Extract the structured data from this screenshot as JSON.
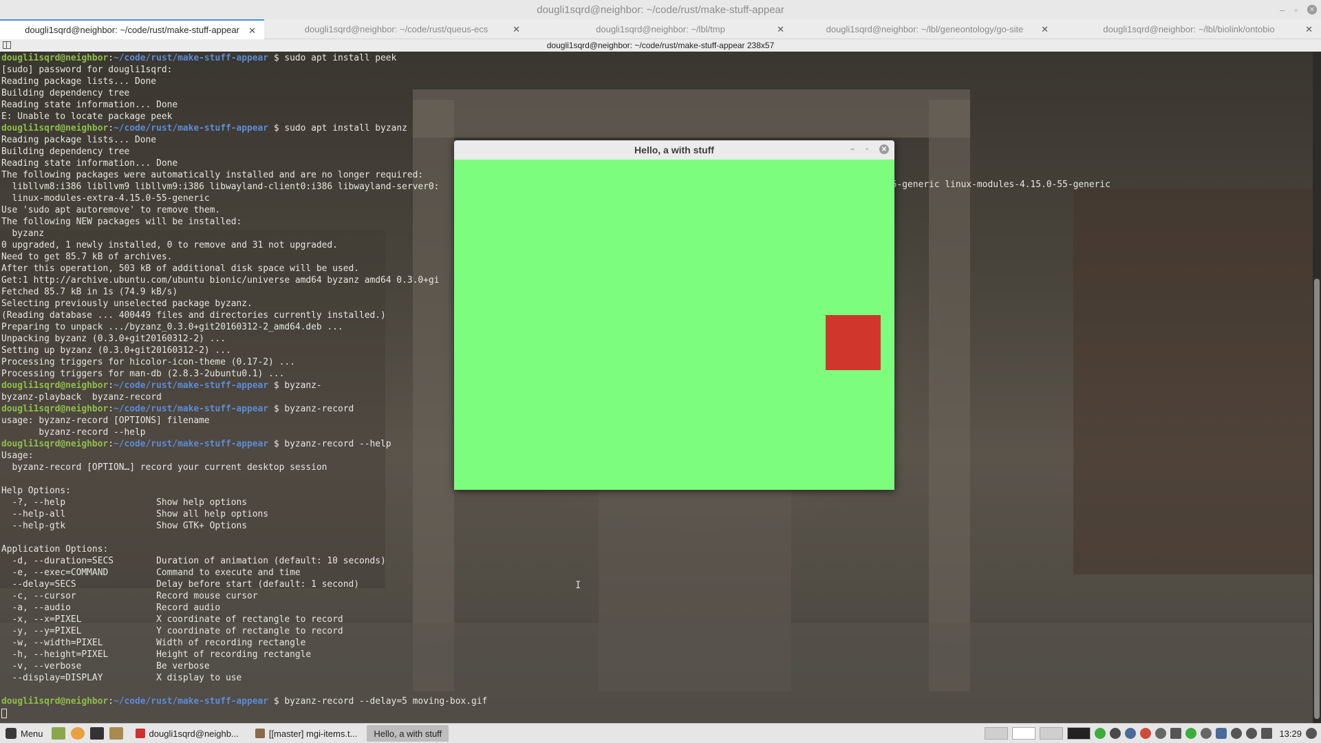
{
  "window": {
    "title": "dougli1sqrd@neighbor: ~/code/rust/make-stuff-appear",
    "subtitle": "dougli1sqrd@neighbor: ~/code/rust/make-stuff-appear 238x57",
    "minimize": "–",
    "maximize": "▫",
    "close": "✕"
  },
  "tabs": [
    {
      "label": "dougli1sqrd@neighbor: ~/code/rust/make-stuff-appear",
      "close": "✕"
    },
    {
      "label": "dougli1sqrd@neighbor: ~/code/rust/queus-ecs",
      "close": "✕"
    },
    {
      "label": "dougli1sqrd@neighbor: ~/lbl/tmp",
      "close": "✕"
    },
    {
      "label": "dougli1sqrd@neighbor: ~/lbl/geneontology/go-site",
      "close": "✕"
    },
    {
      "label": "dougli1sqrd@neighbor: ~/lbl/biolink/ontobio",
      "close": "✕"
    }
  ],
  "prompt": {
    "user": "dougli1sqrd@neighbor",
    "path": "~/code/rust/make-stuff-appear"
  },
  "terminal": {
    "lines": [
      {
        "type": "prompt",
        "cmd": " $ sudo apt install peek"
      },
      {
        "type": "out",
        "text": "[sudo] password for dougli1sqrd:"
      },
      {
        "type": "out",
        "text": "Reading package lists... Done"
      },
      {
        "type": "out",
        "text": "Building dependency tree"
      },
      {
        "type": "out",
        "text": "Reading state information... Done"
      },
      {
        "type": "out",
        "text": "E: Unable to locate package peek"
      },
      {
        "type": "prompt",
        "cmd": " $ sudo apt install byzanz"
      },
      {
        "type": "out",
        "text": "Reading package lists... Done"
      },
      {
        "type": "out",
        "text": "Building dependency tree"
      },
      {
        "type": "out",
        "text": "Reading state information... Done"
      },
      {
        "type": "out",
        "text": "The following packages were automatically installed and are no longer required:"
      },
      {
        "type": "out",
        "text": "  libllvm8:i386 libllvm9 libllvm9:i386 libwayland-client0:i386 libwayland-server0:"
      },
      {
        "type": "out",
        "text": "  linux-modules-extra-4.15.0-55-generic"
      },
      {
        "type": "out",
        "text": "Use 'sudo apt autoremove' to remove them."
      },
      {
        "type": "out",
        "text": "The following NEW packages will be installed:"
      },
      {
        "type": "out",
        "text": "  byzanz"
      },
      {
        "type": "out",
        "text": "0 upgraded, 1 newly installed, 0 to remove and 31 not upgraded."
      },
      {
        "type": "out",
        "text": "Need to get 85.7 kB of archives."
      },
      {
        "type": "out",
        "text": "After this operation, 503 kB of additional disk space will be used."
      },
      {
        "type": "out",
        "text": "Get:1 http://archive.ubuntu.com/ubuntu bionic/universe amd64 byzanz amd64 0.3.0+gi"
      },
      {
        "type": "out",
        "text": "Fetched 85.7 kB in 1s (74.9 kB/s)"
      },
      {
        "type": "out",
        "text": "Selecting previously unselected package byzanz."
      },
      {
        "type": "out",
        "text": "(Reading database ... 400449 files and directories currently installed.)"
      },
      {
        "type": "out",
        "text": "Preparing to unpack .../byzanz_0.3.0+git20160312-2_amd64.deb ..."
      },
      {
        "type": "out",
        "text": "Unpacking byzanz (0.3.0+git20160312-2) ..."
      },
      {
        "type": "out",
        "text": "Setting up byzanz (0.3.0+git20160312-2) ..."
      },
      {
        "type": "out",
        "text": "Processing triggers for hicolor-icon-theme (0.17-2) ..."
      },
      {
        "type": "out",
        "text": "Processing triggers for man-db (2.8.3-2ubuntu0.1) ..."
      },
      {
        "type": "prompt",
        "cmd": " $ byzanz-"
      },
      {
        "type": "out",
        "text": "byzanz-playback  byzanz-record"
      },
      {
        "type": "prompt",
        "cmd": " $ byzanz-record"
      },
      {
        "type": "out",
        "text": "usage: byzanz-record [OPTIONS] filename"
      },
      {
        "type": "out",
        "text": "       byzanz-record --help"
      },
      {
        "type": "prompt",
        "cmd": " $ byzanz-record --help"
      },
      {
        "type": "out",
        "text": "Usage:"
      },
      {
        "type": "out",
        "text": "  byzanz-record [OPTION…] record your current desktop session"
      },
      {
        "type": "out",
        "text": ""
      },
      {
        "type": "out",
        "text": "Help Options:"
      },
      {
        "type": "out",
        "text": "  -?, --help                 Show help options"
      },
      {
        "type": "out",
        "text": "  --help-all                 Show all help options"
      },
      {
        "type": "out",
        "text": "  --help-gtk                 Show GTK+ Options"
      },
      {
        "type": "out",
        "text": ""
      },
      {
        "type": "out",
        "text": "Application Options:"
      },
      {
        "type": "out",
        "text": "  -d, --duration=SECS        Duration of animation (default: 10 seconds)"
      },
      {
        "type": "out",
        "text": "  -e, --exec=COMMAND         Command to execute and time"
      },
      {
        "type": "out",
        "text": "  --delay=SECS               Delay before start (default: 1 second)"
      },
      {
        "type": "out",
        "text": "  -c, --cursor               Record mouse cursor"
      },
      {
        "type": "out",
        "text": "  -a, --audio                Record audio"
      },
      {
        "type": "out",
        "text": "  -x, --x=PIXEL              X coordinate of rectangle to record"
      },
      {
        "type": "out",
        "text": "  -y, --y=PIXEL              Y coordinate of rectangle to record"
      },
      {
        "type": "out",
        "text": "  -w, --width=PIXEL          Width of recording rectangle"
      },
      {
        "type": "out",
        "text": "  -h, --height=PIXEL         Height of recording rectangle"
      },
      {
        "type": "out",
        "text": "  -v, --verbose              Be verbose"
      },
      {
        "type": "out",
        "text": "  --display=DISPLAY          X display to use"
      },
      {
        "type": "out",
        "text": ""
      },
      {
        "type": "prompt",
        "cmd": " $ byzanz-record --delay=5 moving-box.gif"
      },
      {
        "type": "cursor",
        "text": ""
      }
    ],
    "overflow_text": "55-generic linux-modules-4.15.0-55-generic",
    "ibeam": "I"
  },
  "app": {
    "title": "Hello, a with stuff",
    "minimize": "–",
    "maximize": "▫",
    "close": "✕",
    "background_color": "#7dfd7d",
    "box_color": "#d0362b"
  },
  "taskbar": {
    "menu_label": "Menu",
    "tasks": [
      {
        "label": "dougli1sqrd@neighb...",
        "icon_color": "#d03030",
        "active": false
      },
      {
        "label": "[[master] mgi-items.t...",
        "icon_color": "#8a6a4a",
        "active": false
      },
      {
        "label": "Hello, a with stuff",
        "icon_color": "",
        "active": true
      }
    ],
    "clock": "13:29"
  }
}
